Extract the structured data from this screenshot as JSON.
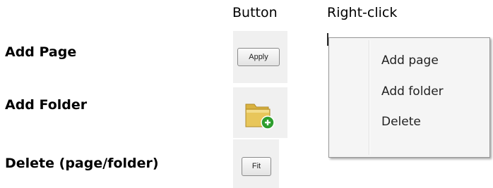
{
  "headers": {
    "button": "Button",
    "right_click": "Right-click"
  },
  "rows": {
    "add_page": "Add Page",
    "add_folder": "Add Folder",
    "delete": "Delete (page/folder)"
  },
  "buttons": {
    "apply_label": "Apply",
    "folder_icon": "folder-add-icon",
    "fit_label": "Fit"
  },
  "context_menu": {
    "items": [
      "Add page",
      "Add folder",
      "Delete"
    ]
  },
  "colors": {
    "folder_body": "#e8c65a",
    "folder_tab": "#d9b240",
    "plus_badge": "#2e9e2e"
  }
}
